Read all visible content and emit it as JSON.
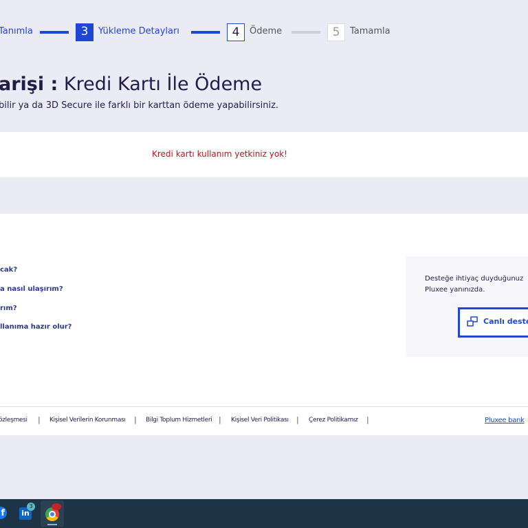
{
  "stepper": {
    "steps": [
      {
        "label": "Tanımla"
      },
      {
        "number": "3",
        "label": "Yükleme Detayları"
      },
      {
        "number": "4",
        "label": "Ödeme"
      },
      {
        "number": "5",
        "label": "Tamamla"
      }
    ]
  },
  "header": {
    "title_bold": "arişi :",
    "title": "Kredi Kartı İle Ödeme",
    "subtitle": "bilir ya da 3D Secure ile farklı bir karttan ödeme yapabilirsiniz."
  },
  "alert": {
    "message": "Kredi kartı kullanım yetkiniz yok!"
  },
  "faq": [
    "cak?",
    "a nasıl ulaşırım?",
    "rım?",
    "llanıma hazır olur?"
  ],
  "support": {
    "text1": "Desteğe ihtiyaç duyduğunuz",
    "text2": "Pluxee yanınızda.",
    "button": "Canlı deste"
  },
  "footer": {
    "links": [
      "özleşmesi",
      "Kişisel Verilerin Korunması",
      "Bilgi Toplum Hizmetleri",
      "Kişisel Veri Politikası",
      "Çerez Politikamız"
    ],
    "sep": "|",
    "right_link": "Pluxee bank"
  },
  "taskbar": {
    "linkedin_badge": "3"
  }
}
